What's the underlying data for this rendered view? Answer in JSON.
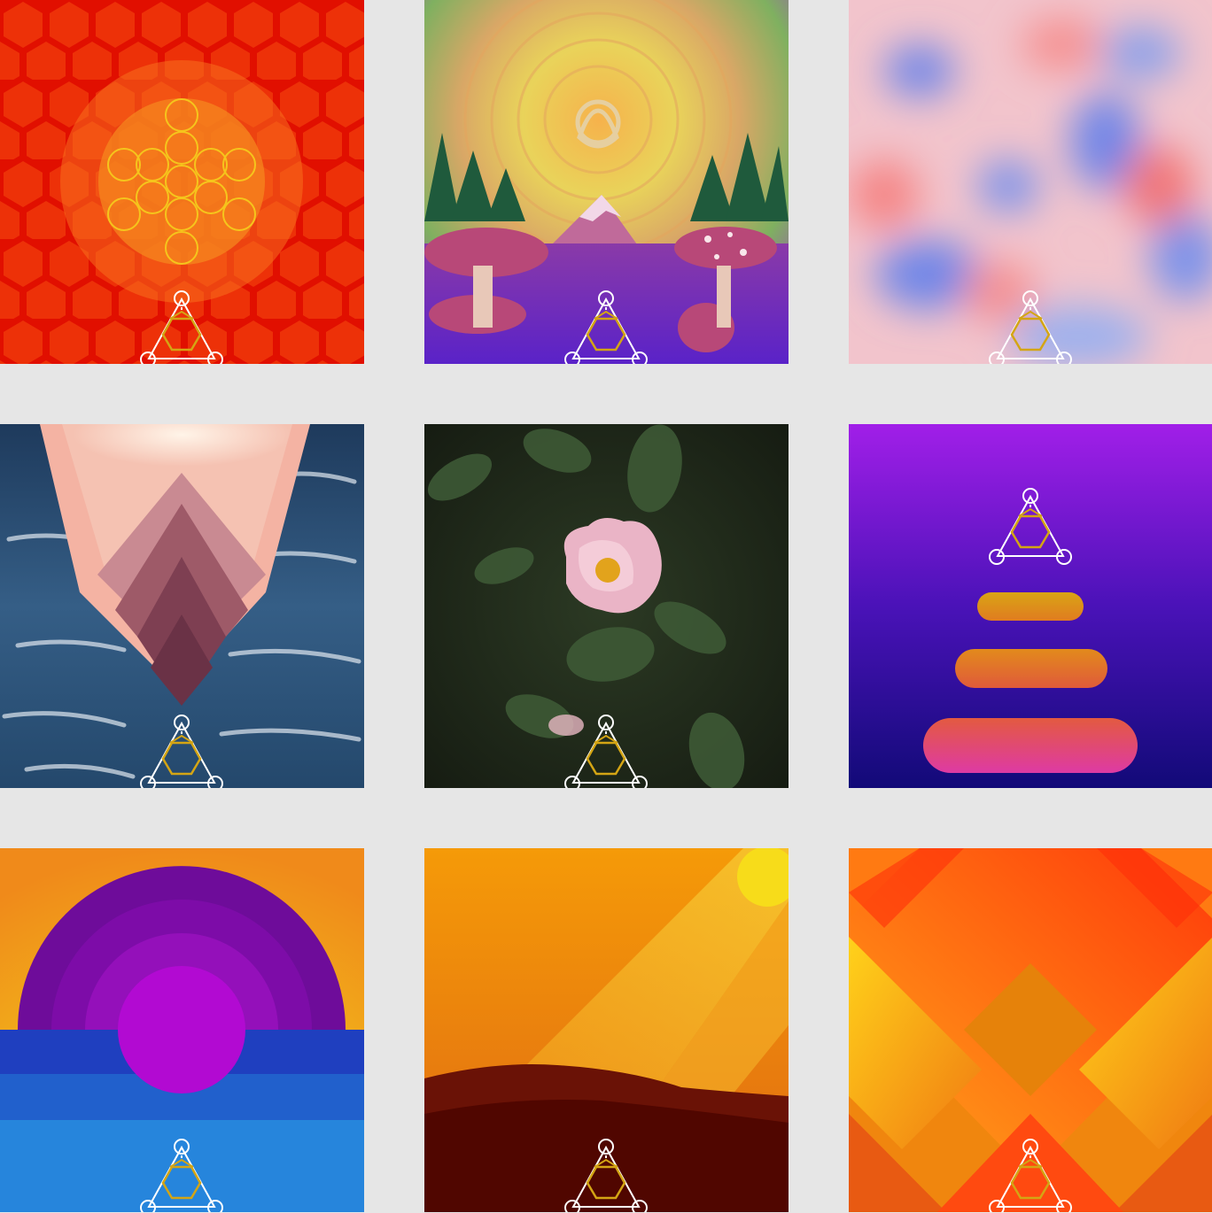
{
  "gallery": {
    "tiles": [
      {
        "name": "tile-honeycomb-flower-of-life",
        "art": "honeycomb-metatron",
        "logo_position": "bottom"
      },
      {
        "name": "tile-psychedelic-mountain-mushrooms",
        "art": "triquetra-mountain-mushrooms",
        "logo_position": "bottom"
      },
      {
        "name": "tile-pink-blue-blur",
        "art": "soft-blur",
        "logo_position": "bottom"
      },
      {
        "name": "tile-ocean-pink-diamonds",
        "art": "ocean-diamond-cascade",
        "logo_position": "bottom"
      },
      {
        "name": "tile-wild-rose-photo",
        "art": "pink-wild-rose",
        "logo_position": "bottom"
      },
      {
        "name": "tile-purple-stacked-bars",
        "art": "gradient-bars",
        "logo_position": "center"
      },
      {
        "name": "tile-purple-rainbow-sunset",
        "art": "purple-sun-ocean",
        "logo_position": "bottom"
      },
      {
        "name": "tile-orange-desert-sun",
        "art": "desert-sunbeam",
        "logo_position": "bottom"
      },
      {
        "name": "tile-orange-weave",
        "art": "orange-woven-pattern",
        "logo_position": "bottom"
      }
    ]
  },
  "colors": {
    "background": "#e6e6e6",
    "logo_white": "#ffffff",
    "logo_gold": "#d4a514"
  },
  "icons": {
    "logo": "triangle-hexagon-logo-icon"
  }
}
